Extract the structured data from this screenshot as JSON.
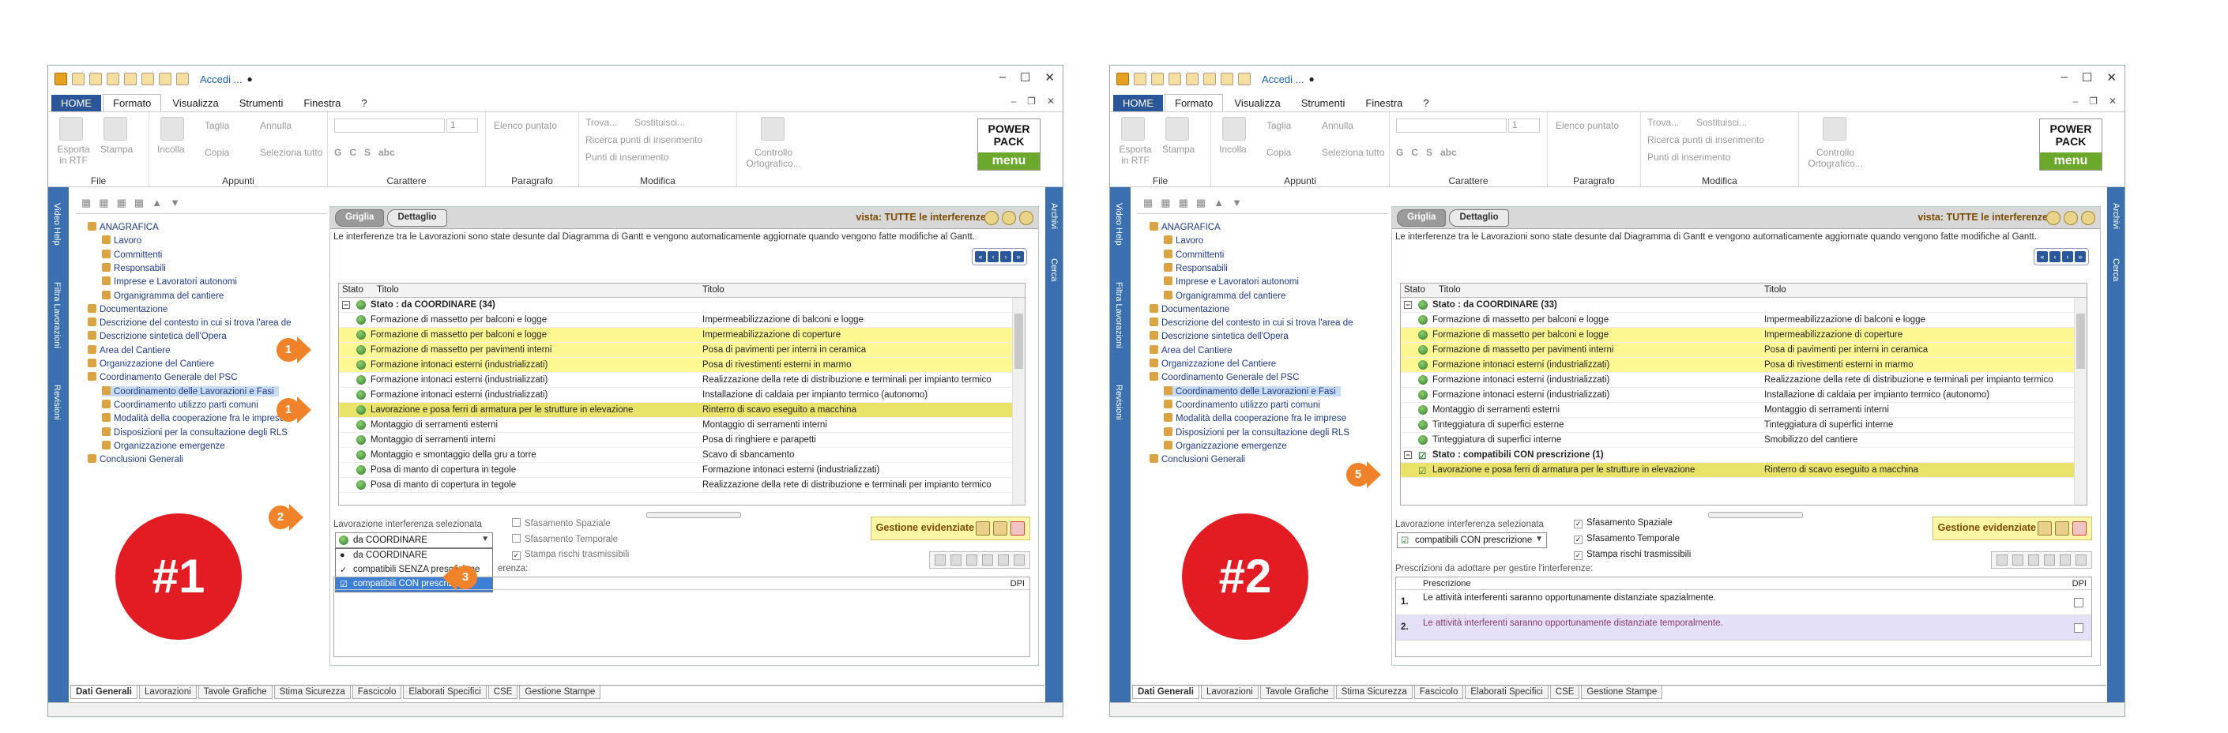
{
  "app": {
    "accedi": "Accedi ...",
    "menu": [
      "HOME",
      "Formato",
      "Visualizza",
      "Strumenti",
      "Finestra",
      "?"
    ],
    "ribbon": {
      "file": {
        "label": "File",
        "items": [
          "Esporta in RTF",
          "Stampa"
        ]
      },
      "appunti": {
        "label": "Appunti",
        "items": [
          "Incolla",
          "Taglia",
          "Copia",
          "Annulla",
          "Seleziona tutto"
        ]
      },
      "carattere": {
        "label": "Carattere",
        "size": "1"
      },
      "paragrafo": {
        "label": "Paragrafo",
        "items": [
          "Elenco puntato"
        ]
      },
      "modifica": {
        "label": "Modifica",
        "items": [
          "Trova...",
          "Sostituisci...",
          "Ricerca punti di inserimento",
          "Punti di inserimento",
          "Controllo Ortografico..."
        ]
      },
      "powerpack": {
        "line1": "POWER",
        "line2": "PACK",
        "menu": "menu"
      }
    },
    "left_sidebar": [
      "Video Help",
      "Filtra Lavorazioni",
      "Revisioni"
    ],
    "right_sidebar": [
      "Archivi",
      "Cerca"
    ]
  },
  "tree": [
    {
      "label": "ANAGRAFICA",
      "level": 0
    },
    {
      "label": "Lavoro",
      "level": 1
    },
    {
      "label": "Committenti",
      "level": 1
    },
    {
      "label": "Responsabili",
      "level": 1
    },
    {
      "label": "Imprese e Lavoratori autonomi",
      "level": 1
    },
    {
      "label": "Organigramma del cantiere",
      "level": 1
    },
    {
      "label": "Documentazione",
      "level": 0
    },
    {
      "label": "Descrizione del contesto in cui si trova l'area de",
      "level": 0
    },
    {
      "label": "Descrizione sintetica dell'Opera",
      "level": 0
    },
    {
      "label": "Area del Cantiere",
      "level": 0
    },
    {
      "label": "Organizzazione del Cantiere",
      "level": 0
    },
    {
      "label": "Coordinamento Generale del PSC",
      "level": 0
    },
    {
      "label": "Coordinamento delle Lavorazioni e Fasi",
      "level": 1
    },
    {
      "label": "Coordinamento utilizzo parti comuni",
      "level": 1
    },
    {
      "label": "Modalità della cooperazione fra le imprese",
      "level": 1
    },
    {
      "label": "Disposizioni per la consultazione degli RLS",
      "level": 1
    },
    {
      "label": "Organizzazione emergenze",
      "level": 1
    },
    {
      "label": "Conclusioni Generali",
      "level": 0
    }
  ],
  "panel": {
    "tab_griglia": "Griglia",
    "tab_dettaglio": "Dettaglio",
    "vista": "vista: TUTTE le interferenze",
    "info": "Le interferenze  tra le Lavorazioni sono state desunte dal Diagramma di Gantt e vengono automaticamente aggiornate quando vengono fatte modifiche al Gantt.",
    "col_stato": "Stato",
    "col_titolo1": "Titolo",
    "col_titolo2": "Titolo",
    "sel_label": "Lavorazione interferenza selezionata",
    "chk_spaziale": "Sfasamento Spaziale",
    "chk_temporale": "Sfasamento Temporale",
    "chk_stampa": "Stampa rischi trasmissibili",
    "gestione": "Gestione evidenziate",
    "prescr_label": "Prescrizioni da adottare per gestire l'interferenze:",
    "prescr_col": "Prescrizione",
    "dpi_col": "DPI"
  },
  "screen1": {
    "badge": "#1",
    "group": "Stato : da COORDINARE (34)",
    "rows": [
      {
        "a": "Formazione di massetto per balconi e logge",
        "b": "Impermeabilizzazione di balconi e logge",
        "hl": ""
      },
      {
        "a": "Formazione di massetto per balconi e logge",
        "b": "Impermeabilizzazione di coperture",
        "hl": "yel"
      },
      {
        "a": "Formazione di massetto per pavimenti interni",
        "b": "Posa di pavimenti per interni in ceramica",
        "hl": "yel"
      },
      {
        "a": "Formazione intonaci esterni (industrializzati)",
        "b": "Posa di rivestimenti esterni in marmo",
        "hl": "yel"
      },
      {
        "a": "Formazione intonaci esterni (industrializzati)",
        "b": "Realizzazione della rete di distribuzione e terminali per impianto termico",
        "hl": ""
      },
      {
        "a": "Formazione intonaci esterni (industrializzati)",
        "b": "Installazione di caldaia per impianto termico (autonomo)",
        "hl": ""
      },
      {
        "a": "Lavorazione e posa ferri di armatura per le strutture in elevazione",
        "b": "Rinterro di scavo eseguito a macchina",
        "hl": "ysel"
      },
      {
        "a": "Montaggio di serramenti esterni",
        "b": "Montaggio di serramenti interni",
        "hl": ""
      },
      {
        "a": "Montaggio di serramenti interni",
        "b": "Posa di ringhiere e parapetti",
        "hl": ""
      },
      {
        "a": "Montaggio e smontaggio della gru a torre",
        "b": "Scavo di sbancamento",
        "hl": ""
      },
      {
        "a": "Posa di manto di copertura in tegole",
        "b": "Formazione intonaci esterni (industrializzati)",
        "hl": ""
      },
      {
        "a": "Posa di manto di copertura in tegole",
        "b": "Realizzazione della rete di distribuzione e terminali per impianto termico",
        "hl": ""
      }
    ],
    "combo": "da COORDINARE",
    "dropdown": [
      "da COORDINARE",
      "compatibili SENZA prescrizione",
      "compatibili CON prescrizione"
    ],
    "prescr_partial": "erenza:",
    "arrows": [
      "1",
      "1",
      "2",
      "3"
    ]
  },
  "screen2": {
    "badge": "#2",
    "group": "Stato : da COORDINARE (33)",
    "rows": [
      {
        "a": "Formazione di massetto per balconi e logge",
        "b": "Impermeabilizzazione di balconi e logge",
        "hl": ""
      },
      {
        "a": "Formazione di massetto per balconi e logge",
        "b": "Impermeabilizzazione di coperture",
        "hl": "yel"
      },
      {
        "a": "Formazione di massetto per pavimenti interni",
        "b": "Posa di pavimenti per interni in ceramica",
        "hl": "yel"
      },
      {
        "a": "Formazione intonaci esterni (industrializzati)",
        "b": "Posa di rivestimenti esterni in marmo",
        "hl": "yel"
      },
      {
        "a": "Formazione intonaci esterni (industrializzati)",
        "b": "Realizzazione della rete di distribuzione e terminali per impianto termico",
        "hl": ""
      },
      {
        "a": "Formazione intonaci esterni (industrializzati)",
        "b": "Installazione di caldaia per impianto termico (autonomo)",
        "hl": ""
      },
      {
        "a": "Montaggio di serramenti esterni",
        "b": "Montaggio di serramenti interni",
        "hl": ""
      },
      {
        "a": "Tinteggiatura di superfici esterne",
        "b": "Tinteggiatura di superfici interne",
        "hl": ""
      },
      {
        "a": "Tinteggiatura di superfici interne",
        "b": "Smobilizzo del cantiere",
        "hl": ""
      }
    ],
    "group2": "Stato : compatibili CON prescrizione  (1)",
    "row2": {
      "a": "Lavorazione e posa ferri di armatura per le strutture in elevazione",
      "b": "Rinterro di scavo eseguito a macchina"
    },
    "combo": "compatibili CON prescrizione",
    "prescrizioni": [
      {
        "n": "1.",
        "t": "Le attività interferenti saranno opportunamente distanziate spazialmente."
      },
      {
        "n": "2.",
        "t": "Le attività interferenti saranno opportunamente distanziate temporalmente."
      }
    ],
    "arrow": "5"
  },
  "bottom_tabs": [
    "Dati Generali",
    "Lavorazioni",
    "Tavole Grafiche",
    "Stima Sicurezza",
    "Fascicolo",
    "Elaborati Specifici",
    "CSE",
    "Gestione Stampe"
  ],
  "colors": {
    "accent": "#2b579a",
    "highlight": "#fdf791",
    "badge": "#e31b23",
    "arrow": "#f0832a"
  }
}
